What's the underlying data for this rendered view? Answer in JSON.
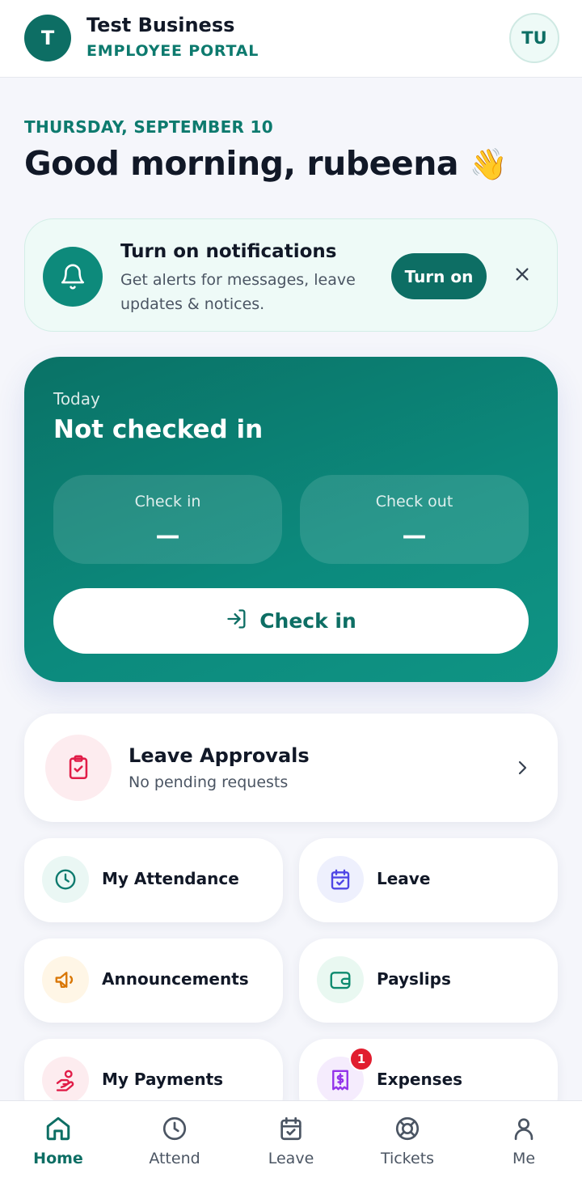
{
  "header": {
    "business_initial": "T",
    "business_name": "Test Business",
    "portal_label": "EMPLOYEE PORTAL",
    "user_initials": "TU"
  },
  "greeting": {
    "date": "THURSDAY, SEPTEMBER 10",
    "text": "Good morning, rubeena",
    "emoji": "👋"
  },
  "notification": {
    "title": "Turn on notifications",
    "description": "Get alerts for messages, leave updates & notices.",
    "button_label": "Turn on",
    "icon": "bell-icon"
  },
  "attendance": {
    "today_label": "Today",
    "status": "Not checked in",
    "check_in_label": "Check in",
    "check_in_value": "—",
    "check_out_label": "Check out",
    "check_out_value": "—",
    "action_label": "Check in"
  },
  "approvals": {
    "title": "Leave Approvals",
    "subtitle": "No pending requests",
    "icon": "clipboard-check-icon"
  },
  "tiles": [
    {
      "label": "My Attendance",
      "icon": "clock-icon",
      "color": "#0d7a6e",
      "bg": "#eaf7f4"
    },
    {
      "label": "Leave",
      "icon": "calendar-icon",
      "color": "#4f46e5",
      "bg": "#eef0fd"
    },
    {
      "label": "Announcements",
      "icon": "megaphone-icon",
      "color": "#d97706",
      "bg": "#fff6e6"
    },
    {
      "label": "Payslips",
      "icon": "wallet-icon",
      "color": "#0d8a6e",
      "bg": "#e9f8f1"
    },
    {
      "label": "My Payments",
      "icon": "hand-coins-icon",
      "color": "#e11d48",
      "bg": "#fdecef"
    },
    {
      "label": "Expenses",
      "icon": "receipt-icon",
      "color": "#9333ea",
      "bg": "#f5ecfd",
      "badge": "1"
    }
  ],
  "nav": [
    {
      "label": "Home",
      "icon": "home-icon",
      "active": true
    },
    {
      "label": "Attend",
      "icon": "clock-icon"
    },
    {
      "label": "Leave",
      "icon": "calendar-icon"
    },
    {
      "label": "Tickets",
      "icon": "lifebuoy-icon"
    },
    {
      "label": "Me",
      "icon": "user-icon"
    }
  ],
  "colors": {
    "primary": "#0d6e64",
    "accent_text": "#0d7a6e",
    "badge": "#e11d2e"
  }
}
